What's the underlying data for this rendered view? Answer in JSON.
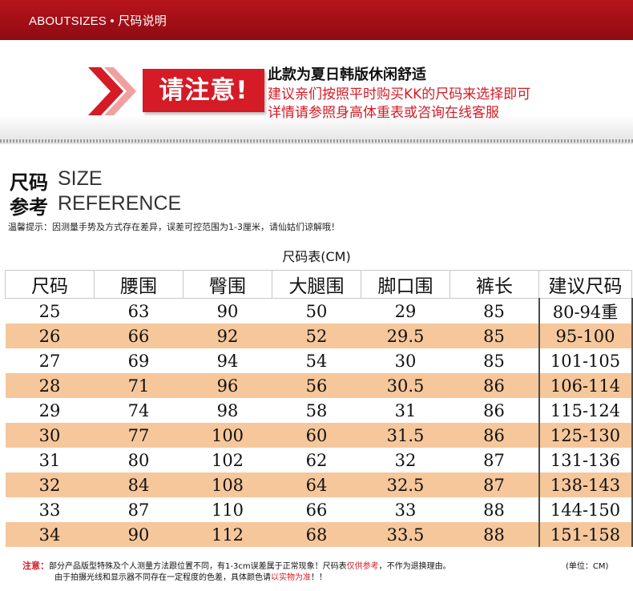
{
  "header": {
    "title": "ABOUTSIZES • 尺码说明"
  },
  "notice": {
    "badge": "请注意!",
    "line1": "此款为夏日韩版休闲舒适",
    "line2": "建议亲们按照平时购买KK的尺码来选择即可",
    "line3": "详情请参照身高体重表或咨询在线客服"
  },
  "section": {
    "cn1": "尺码",
    "en1": "SIZE",
    "cn2": "参考",
    "en2": "REFERENCE",
    "tip": "温馨提示：因测量手势及方式存在差异，误差可控范围为1-3厘米，请仙姑们谅解哦！"
  },
  "table": {
    "title": "尺码表(CM)",
    "headers": [
      "尺码",
      "腰围",
      "臀围",
      "大腿围",
      "脚口围",
      "裤长",
      "建议尺码"
    ],
    "rows": [
      [
        "25",
        "63",
        "90",
        "50",
        "29",
        "85",
        "80-94重"
      ],
      [
        "26",
        "66",
        "92",
        "52",
        "29.5",
        "85",
        "95-100"
      ],
      [
        "27",
        "69",
        "94",
        "54",
        "30",
        "85",
        "101-105"
      ],
      [
        "28",
        "71",
        "96",
        "56",
        "30.5",
        "86",
        "106-114"
      ],
      [
        "29",
        "74",
        "98",
        "58",
        "31",
        "86",
        "115-124"
      ],
      [
        "30",
        "77",
        "100",
        "60",
        "31.5",
        "86",
        "125-130"
      ],
      [
        "31",
        "80",
        "102",
        "62",
        "32",
        "87",
        "131-136"
      ],
      [
        "32",
        "84",
        "108",
        "64",
        "32.5",
        "87",
        "138-143"
      ],
      [
        "33",
        "87",
        "110",
        "66",
        "33",
        "88",
        "144-150"
      ],
      [
        "34",
        "90",
        "112",
        "68",
        "33.5",
        "88",
        "151-158"
      ]
    ]
  },
  "footer": {
    "label": "注意：",
    "text1a": "部分产品版型特殊及个人测量方法跟位置不同，有1-3cm误差属于正常现象！尺码表",
    "text1b": "仅供参考",
    "text1c": "，不作为退换理由。",
    "unit": "(单位：CM)",
    "text2a": "由于拍摄光线和显示器不同存在一定程度的色差，具体颜色请",
    "text2b": "以实物为准",
    "text2c": "！！"
  },
  "colors": {
    "brand_red": "#d41b26",
    "header_bar": "#b8141c",
    "row_highlight": "#f6c79b"
  }
}
